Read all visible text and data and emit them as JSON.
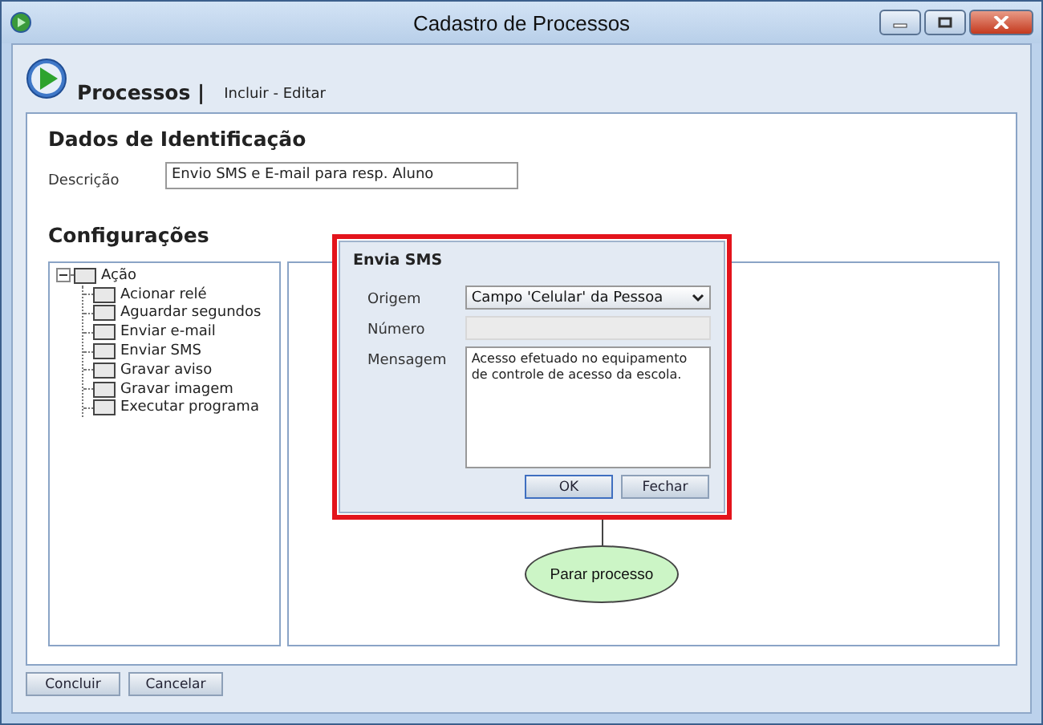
{
  "window": {
    "title": "Cadastro de Processos"
  },
  "header": {
    "title": "Processos |",
    "subtitle": "Incluir - Editar"
  },
  "identificacao": {
    "heading": "Dados de Identificação",
    "fields": [
      {
        "label": "Descrição",
        "value": "Envio SMS e E-mail para resp. Aluno"
      }
    ]
  },
  "configuracoes": {
    "heading": "Configurações",
    "tree": [
      {
        "label": "Ação",
        "expanded": true,
        "children": [
          {
            "label": "Acionar relé"
          },
          {
            "label": "Aguardar segundos"
          },
          {
            "label": "Enviar e-mail"
          },
          {
            "label": "Enviar SMS"
          },
          {
            "label": "Gravar aviso"
          },
          {
            "label": "Gravar imagem"
          },
          {
            "label": "Executar programa"
          }
        ]
      }
    ]
  },
  "canvas": {
    "nodes": [
      {
        "label": "Parar processo"
      }
    ]
  },
  "dialog": {
    "title": "Envia SMS",
    "fields": [
      {
        "kind": "select",
        "label": "Origem",
        "value": "Campo 'Celular' da Pessoa"
      },
      {
        "kind": "input",
        "label": "Número",
        "disabled": true
      },
      {
        "kind": "textarea",
        "label": "Mensagem",
        "value": "Acesso efetuado no equipamento de controle de acesso da escola."
      }
    ],
    "buttons": [
      {
        "label": "OK",
        "default": true
      },
      {
        "label": "Fechar",
        "default": false
      }
    ]
  },
  "buttons": [
    "Concluir",
    "Cancelar"
  ]
}
